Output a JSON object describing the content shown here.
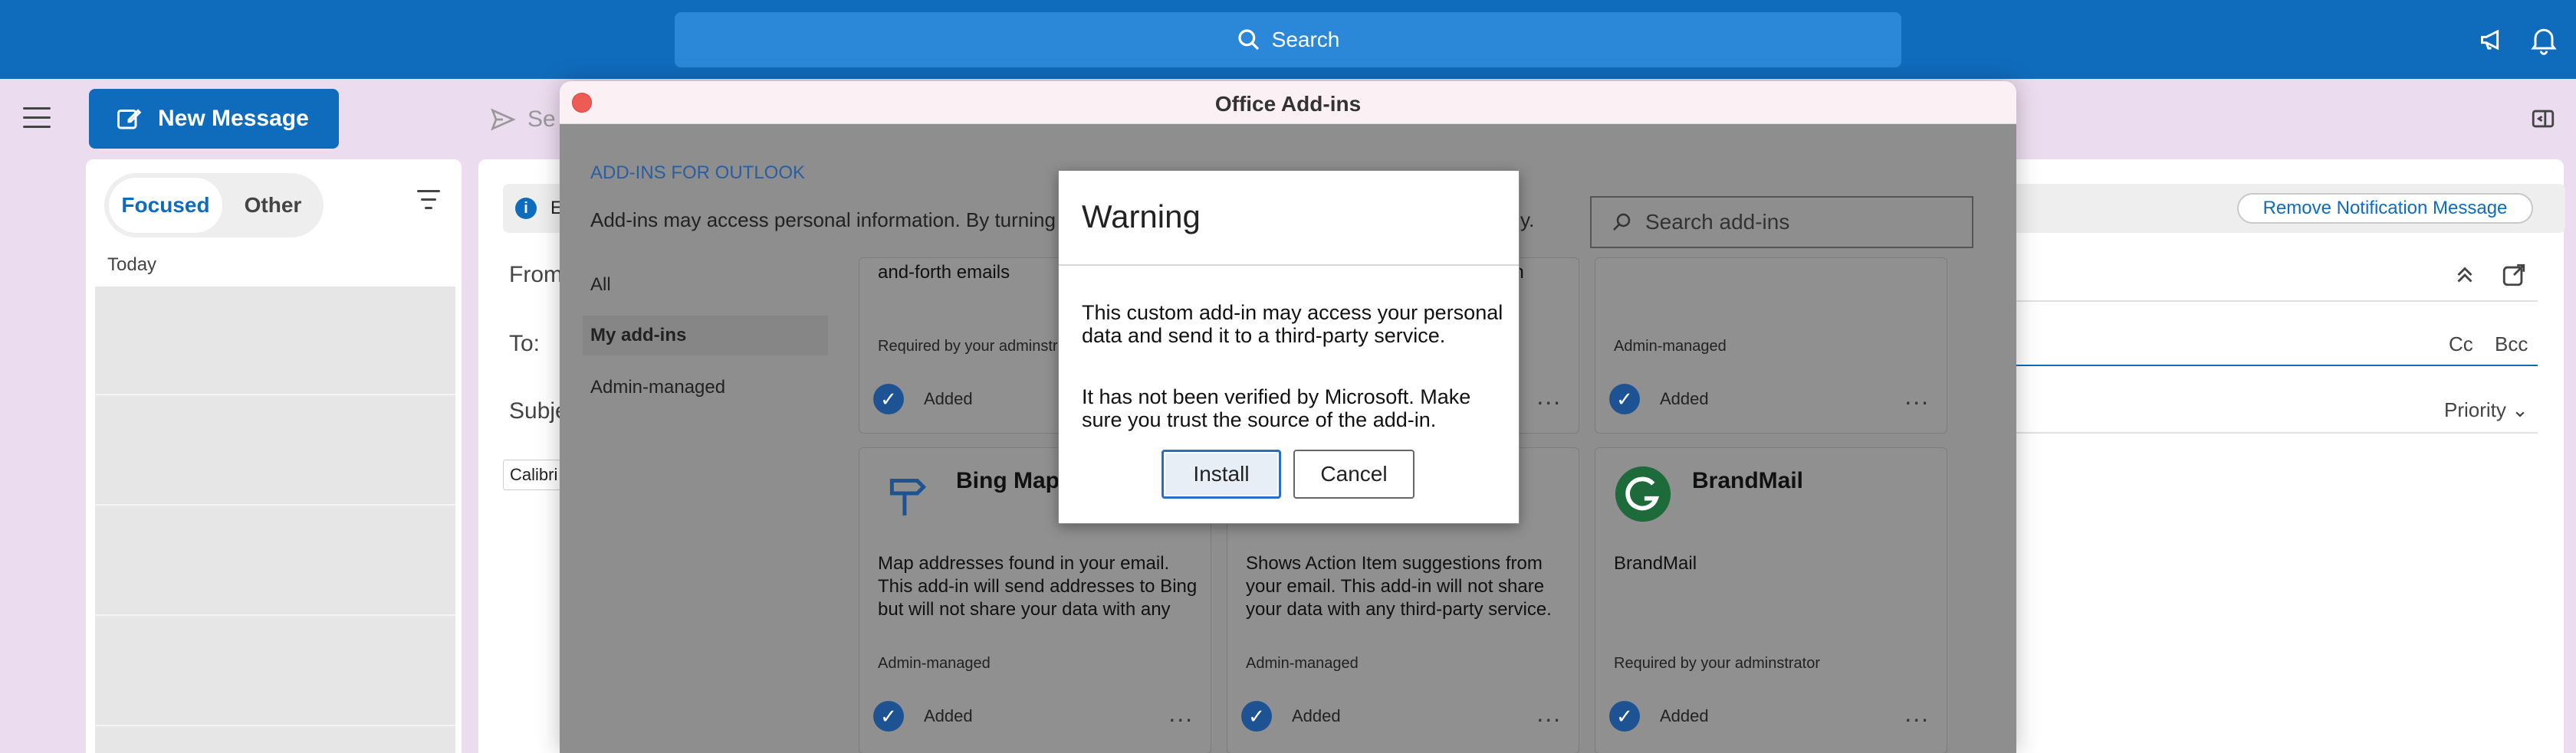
{
  "topbar": {
    "search_label": "Search"
  },
  "left": {
    "new_message": "New Message",
    "tabs": [
      "Focused",
      "Other"
    ],
    "today": "Today"
  },
  "compose": {
    "send_partial": "Se",
    "info_partial": "E",
    "remove_notification": "Remove Notification Message",
    "from_label": "From",
    "to_label": "To:",
    "subject_partial": "Subje",
    "cc": "Cc",
    "bcc": "Bcc",
    "priority": "Priority",
    "font": "Calibri"
  },
  "addins": {
    "window_title": "Office Add-ins",
    "heading": "ADD-INS FOR OUTLOOK",
    "description": "Add-ins may access personal information. By turning an a",
    "description_tail": "cy.",
    "search_placeholder": "Search add-ins",
    "nav": [
      "All",
      "My add-ins",
      "Admin-managed"
    ],
    "cards": [
      {
        "name": "",
        "desc": "and-forth emails",
        "meta": "Required by your adminstrator",
        "status": "Added"
      },
      {
        "name": "",
        "desc": "hem\not",
        "meta": "",
        "status": ""
      },
      {
        "name": "",
        "desc": "",
        "meta": "Admin-managed",
        "status": "Added"
      },
      {
        "name": "Bing Maps",
        "desc": "Map addresses found in your email. This add-in will send addresses to Bing but will not share your data with any",
        "meta": "Admin-managed",
        "status": "Added"
      },
      {
        "name": "",
        "desc": "Shows Action Item suggestions from your email. This add-in will not share your data with any third-party service.",
        "meta": "Admin-managed",
        "status": "Added"
      },
      {
        "name": "BrandMail",
        "desc": "BrandMail",
        "meta": "Required by your adminstrator",
        "status": "Added"
      }
    ],
    "more": "..."
  },
  "warning": {
    "title": "Warning",
    "text1": "This custom add-in may access your personal data and send it to a third-party service.",
    "text2": "It has not been verified by Microsoft. Make sure you trust the source of the add-in.",
    "install": "Install",
    "cancel": "Cancel"
  },
  "colors": {
    "brand": "#0f6cbd",
    "overlay_grey": "#8e8e8e",
    "close_red": "#ee5b55"
  }
}
